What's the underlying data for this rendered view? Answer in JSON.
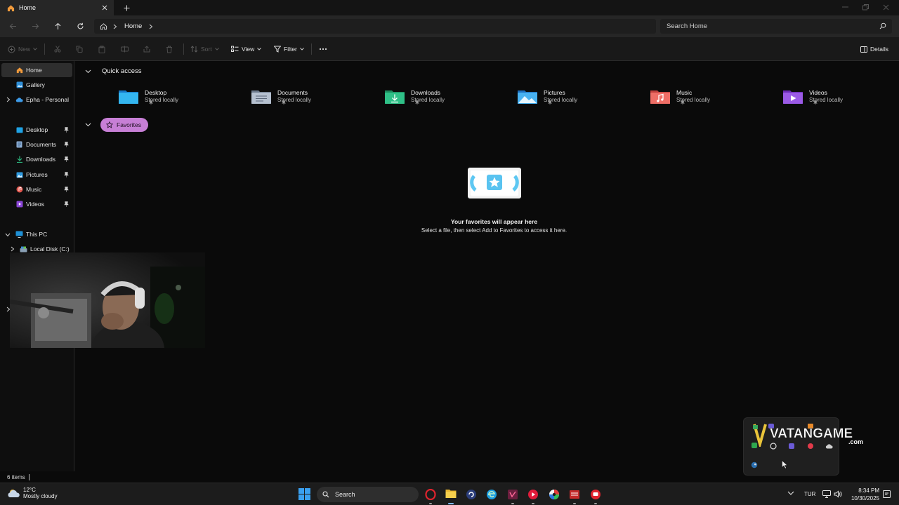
{
  "window": {
    "tab_title": "Home",
    "search_placeholder": "Search Home",
    "breadcrumb": [
      "Home"
    ]
  },
  "toolbar": {
    "new_label": "New",
    "sort_label": "Sort",
    "view_label": "View",
    "filter_label": "Filter",
    "details_label": "Details"
  },
  "sidebar": {
    "top": [
      {
        "label": "Home",
        "icon": "home-icon",
        "selected": true
      },
      {
        "label": "Gallery",
        "icon": "gallery-icon"
      },
      {
        "label": "Epha - Personal",
        "icon": "onedrive-icon"
      }
    ],
    "pinned": [
      {
        "label": "Desktop",
        "icon": "desktop-folder-icon"
      },
      {
        "label": "Documents",
        "icon": "documents-folder-icon"
      },
      {
        "label": "Downloads",
        "icon": "downloads-folder-icon"
      },
      {
        "label": "Pictures",
        "icon": "pictures-folder-icon"
      },
      {
        "label": "Music",
        "icon": "music-folder-icon"
      },
      {
        "label": "Videos",
        "icon": "videos-folder-icon"
      }
    ],
    "this_pc": "This PC",
    "local_disk": "Local Disk (C:)"
  },
  "main": {
    "quick_access_title": "Quick access",
    "quick_access": [
      {
        "name": "Desktop",
        "status": "Stored locally",
        "color": "#1fa3e5"
      },
      {
        "name": "Documents",
        "status": "Stored locally",
        "color": "#9aa6b8"
      },
      {
        "name": "Downloads",
        "status": "Stored locally",
        "color": "#2cb67d"
      },
      {
        "name": "Pictures",
        "status": "Stored locally",
        "color": "#2f9be0"
      },
      {
        "name": "Music",
        "status": "Stored locally",
        "color": "#e2584f"
      },
      {
        "name": "Videos",
        "status": "Stored locally",
        "color": "#8a45d6"
      }
    ],
    "favorites_title": "Favorites",
    "favorites_empty_title": "Your favorites will appear here",
    "favorites_empty_sub": "Select a file, then select Add to Favorites to access it here."
  },
  "status": {
    "items_count": "6 items"
  },
  "overlay": {
    "brand_text": "VATANGAME",
    "brand_sub": ".com"
  },
  "taskbar": {
    "weather_temp": "12°C",
    "weather_cond": "Mostly cloudy",
    "search_label": "Search",
    "language": "TUR",
    "time": "8:34 PM",
    "date": "10/30/2025"
  }
}
